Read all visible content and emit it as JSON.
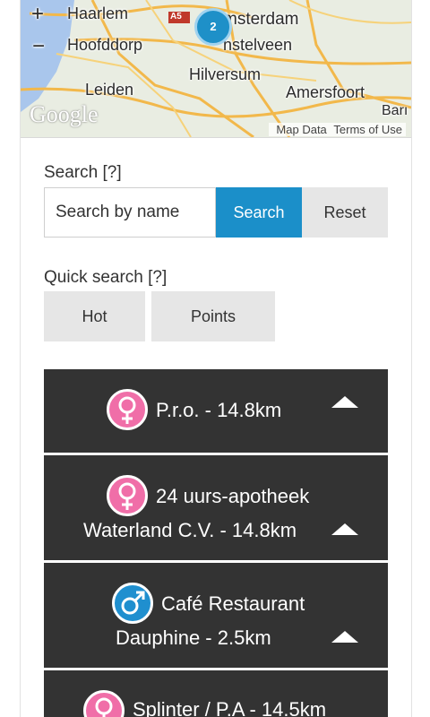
{
  "map": {
    "zoom_in": "+",
    "zoom_out": "−",
    "cities": [
      "Haarlem",
      "msterdam",
      "Hoofddorp",
      "nstelveen",
      "Hilversum",
      "Leiden",
      "Amersfoort",
      "Barı"
    ],
    "cluster_count": "2",
    "road_sign": "A5",
    "logo": "Google",
    "attribution_data": "Map Data",
    "attribution_terms": "Terms of Use"
  },
  "search": {
    "label": "Search [?]",
    "placeholder": "Search by name",
    "search_button": "Search",
    "reset_button": "Reset"
  },
  "quick_search": {
    "label": "Quick search [?]",
    "buttons": [
      "Hot",
      "Points"
    ]
  },
  "results": [
    {
      "gender": "female",
      "line1": "P.r.o. - 14.8km",
      "line2": ""
    },
    {
      "gender": "female",
      "line1": "24 uurs-apotheek",
      "line2": "Waterland C.V. - 14.8km"
    },
    {
      "gender": "male",
      "line1": "Café Restaurant",
      "line2": "Dauphine - 2.5km"
    },
    {
      "gender": "female",
      "line1": "Splinter / P.A - 14.5km",
      "line2": ""
    }
  ],
  "colors": {
    "accent": "#1b8fc9",
    "female_icon": "#f06ea8",
    "male_icon": "#1f8fcf",
    "result_bg": "#333333"
  }
}
